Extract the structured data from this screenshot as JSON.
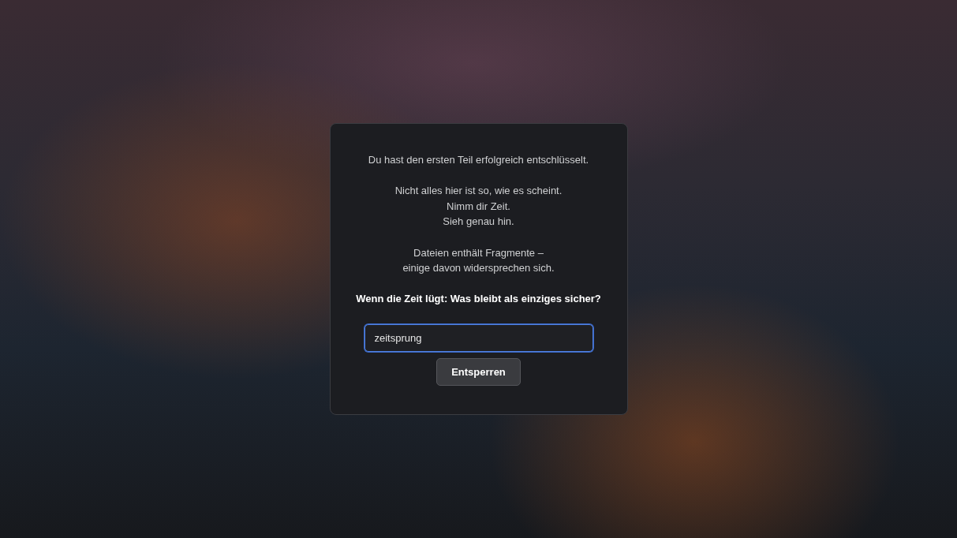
{
  "dialog": {
    "paragraphs": [
      {
        "lines": [
          "Du hast den ersten Teil erfolgreich entschlüsselt."
        ],
        "bold": false
      },
      {
        "lines": [
          "Nicht alles hier ist so, wie es scheint.",
          "Nimm dir Zeit.",
          "Sieh genau hin."
        ],
        "bold": false
      },
      {
        "lines": [
          "Dateien enthält Fragmente –",
          "einige davon widersprechen sich."
        ],
        "bold": false
      },
      {
        "lines": [
          "Wenn die Zeit lügt: Was bleibt als einziges sicher?"
        ],
        "bold": true
      }
    ],
    "input": {
      "value": "zeitsprung",
      "focused": true
    },
    "button": {
      "label": "Entsperren"
    }
  }
}
